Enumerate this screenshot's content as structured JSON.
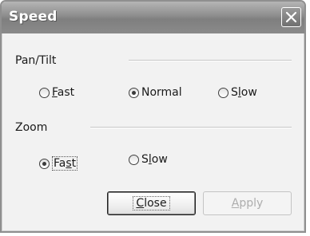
{
  "window": {
    "title": "Speed",
    "close_icon": "close-icon"
  },
  "pan_tilt": {
    "label": "Pan/Tilt",
    "options": [
      {
        "label": "Fast",
        "accesskey": "F",
        "checked": false
      },
      {
        "label": "Normal",
        "accesskey": "",
        "checked": true
      },
      {
        "label": "Slow",
        "accesskey": "l",
        "checked": false
      }
    ]
  },
  "zoom": {
    "label": "Zoom",
    "options": [
      {
        "label": "Fast",
        "accesskey": "s",
        "checked": true,
        "focused": true
      },
      {
        "label": "Slow",
        "accesskey": "l",
        "checked": false
      }
    ]
  },
  "buttons": {
    "close_label": "Close",
    "close_accesskey": "C",
    "apply_label": "Apply",
    "apply_accesskey": "A",
    "apply_enabled": false
  },
  "colors": {
    "titlebar": "#8d8d8d",
    "client_bg": "#f2f2f2",
    "title_text": "#ffffff",
    "disabled_text": "#adadad"
  }
}
